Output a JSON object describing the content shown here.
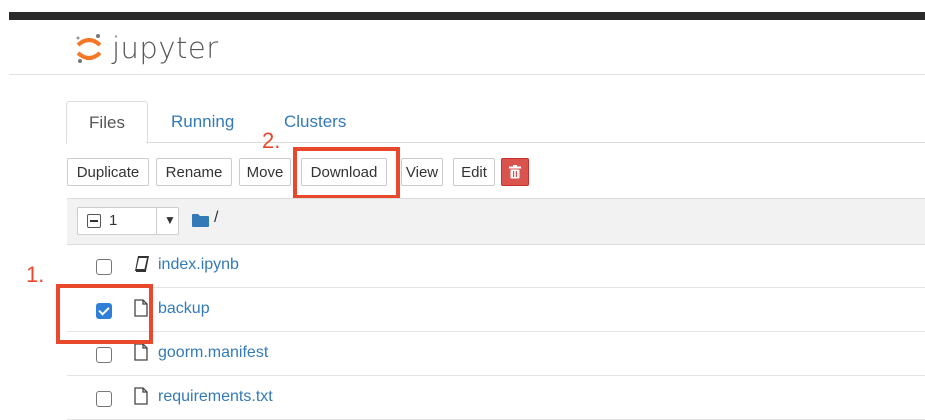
{
  "app": {
    "logo_text": "jupyter"
  },
  "tabs": [
    {
      "label": "Files",
      "active": true
    },
    {
      "label": "Running",
      "active": false
    },
    {
      "label": "Clusters",
      "active": false
    }
  ],
  "toolbar": {
    "duplicate": "Duplicate",
    "rename": "Rename",
    "move": "Move",
    "download": "Download",
    "view": "View",
    "edit": "Edit",
    "delete_icon": "trash-icon"
  },
  "list_header": {
    "selected_count": "1",
    "path": "/"
  },
  "files": [
    {
      "name": "index.ipynb",
      "icon": "notebook-icon",
      "checked": false
    },
    {
      "name": "backup",
      "icon": "file-icon",
      "checked": true
    },
    {
      "name": "goorm.manifest",
      "icon": "file-icon",
      "checked": false
    },
    {
      "name": "requirements.txt",
      "icon": "file-icon",
      "checked": false
    }
  ],
  "annotations": {
    "step1": "1.",
    "step2": "2."
  },
  "colors": {
    "accent": "#337ab7",
    "annotation": "#e8482c",
    "delete": "#d9534f",
    "checkbox": "#2f7ed8"
  }
}
